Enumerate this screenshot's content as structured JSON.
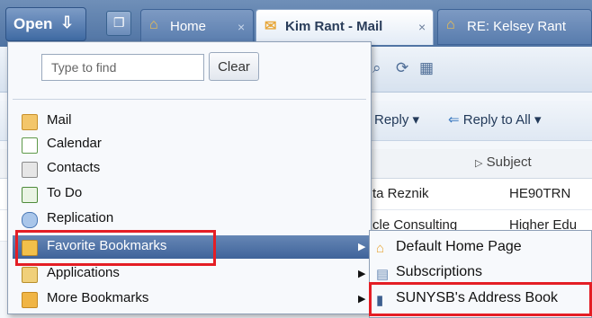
{
  "tabbar": {
    "open_label": "Open",
    "open_icon": "download-arrow-icon",
    "tabs": [
      {
        "label": "Home",
        "icon": "house-icon",
        "close": "×"
      },
      {
        "label": "Kim Rant - Mail",
        "icon": "mail-icon",
        "close": "×"
      },
      {
        "label": "RE: Kelsey Rant",
        "icon": "house-icon"
      }
    ]
  },
  "search": {
    "placeholder": "Type to find",
    "clear_label": "Clear"
  },
  "menu": {
    "items": [
      {
        "label": "Mail",
        "icon": "mail-icon",
        "color": "#e8a73a"
      },
      {
        "label": "Calendar",
        "icon": "calendar-icon",
        "color": "#5f9a4a"
      },
      {
        "label": "Contacts",
        "icon": "contacts-icon",
        "color": "#8a8a8a"
      },
      {
        "label": "To Do",
        "icon": "checkbox-icon",
        "color": "#4e8b3a"
      },
      {
        "label": "Replication",
        "icon": "replication-icon",
        "color": "#4a78b5"
      },
      {
        "label": "Favorite Bookmarks",
        "icon": "bookmark-folder-icon",
        "color": "#e8b23a",
        "arrow": "▶"
      },
      {
        "label": "Applications",
        "icon": "applications-icon",
        "color": "#d9a233",
        "arrow": "▶"
      },
      {
        "label": "More Bookmarks",
        "icon": "folder-icon",
        "color": "#f0b545",
        "arrow": "▶"
      }
    ]
  },
  "submenu": {
    "items": [
      {
        "label": "Default Home Page",
        "icon": "home-page-icon"
      },
      {
        "label": "Subscriptions",
        "icon": "subscriptions-icon"
      },
      {
        "label": "SUNYSB's Address Book",
        "icon": "address-book-icon"
      }
    ]
  },
  "mail": {
    "actions": {
      "reply": "Reply",
      "reply_all": "Reply to All",
      "dropdown": "▾"
    },
    "column_subject": "Subject",
    "rows": [
      {
        "sender": "ta Reznik",
        "subject": "HE90TRN"
      },
      {
        "sender": "cle Consulting",
        "subject": "Higher Edu"
      }
    ]
  },
  "colors": {
    "accent": "#e41e25",
    "highlight": "#4f73a3"
  }
}
